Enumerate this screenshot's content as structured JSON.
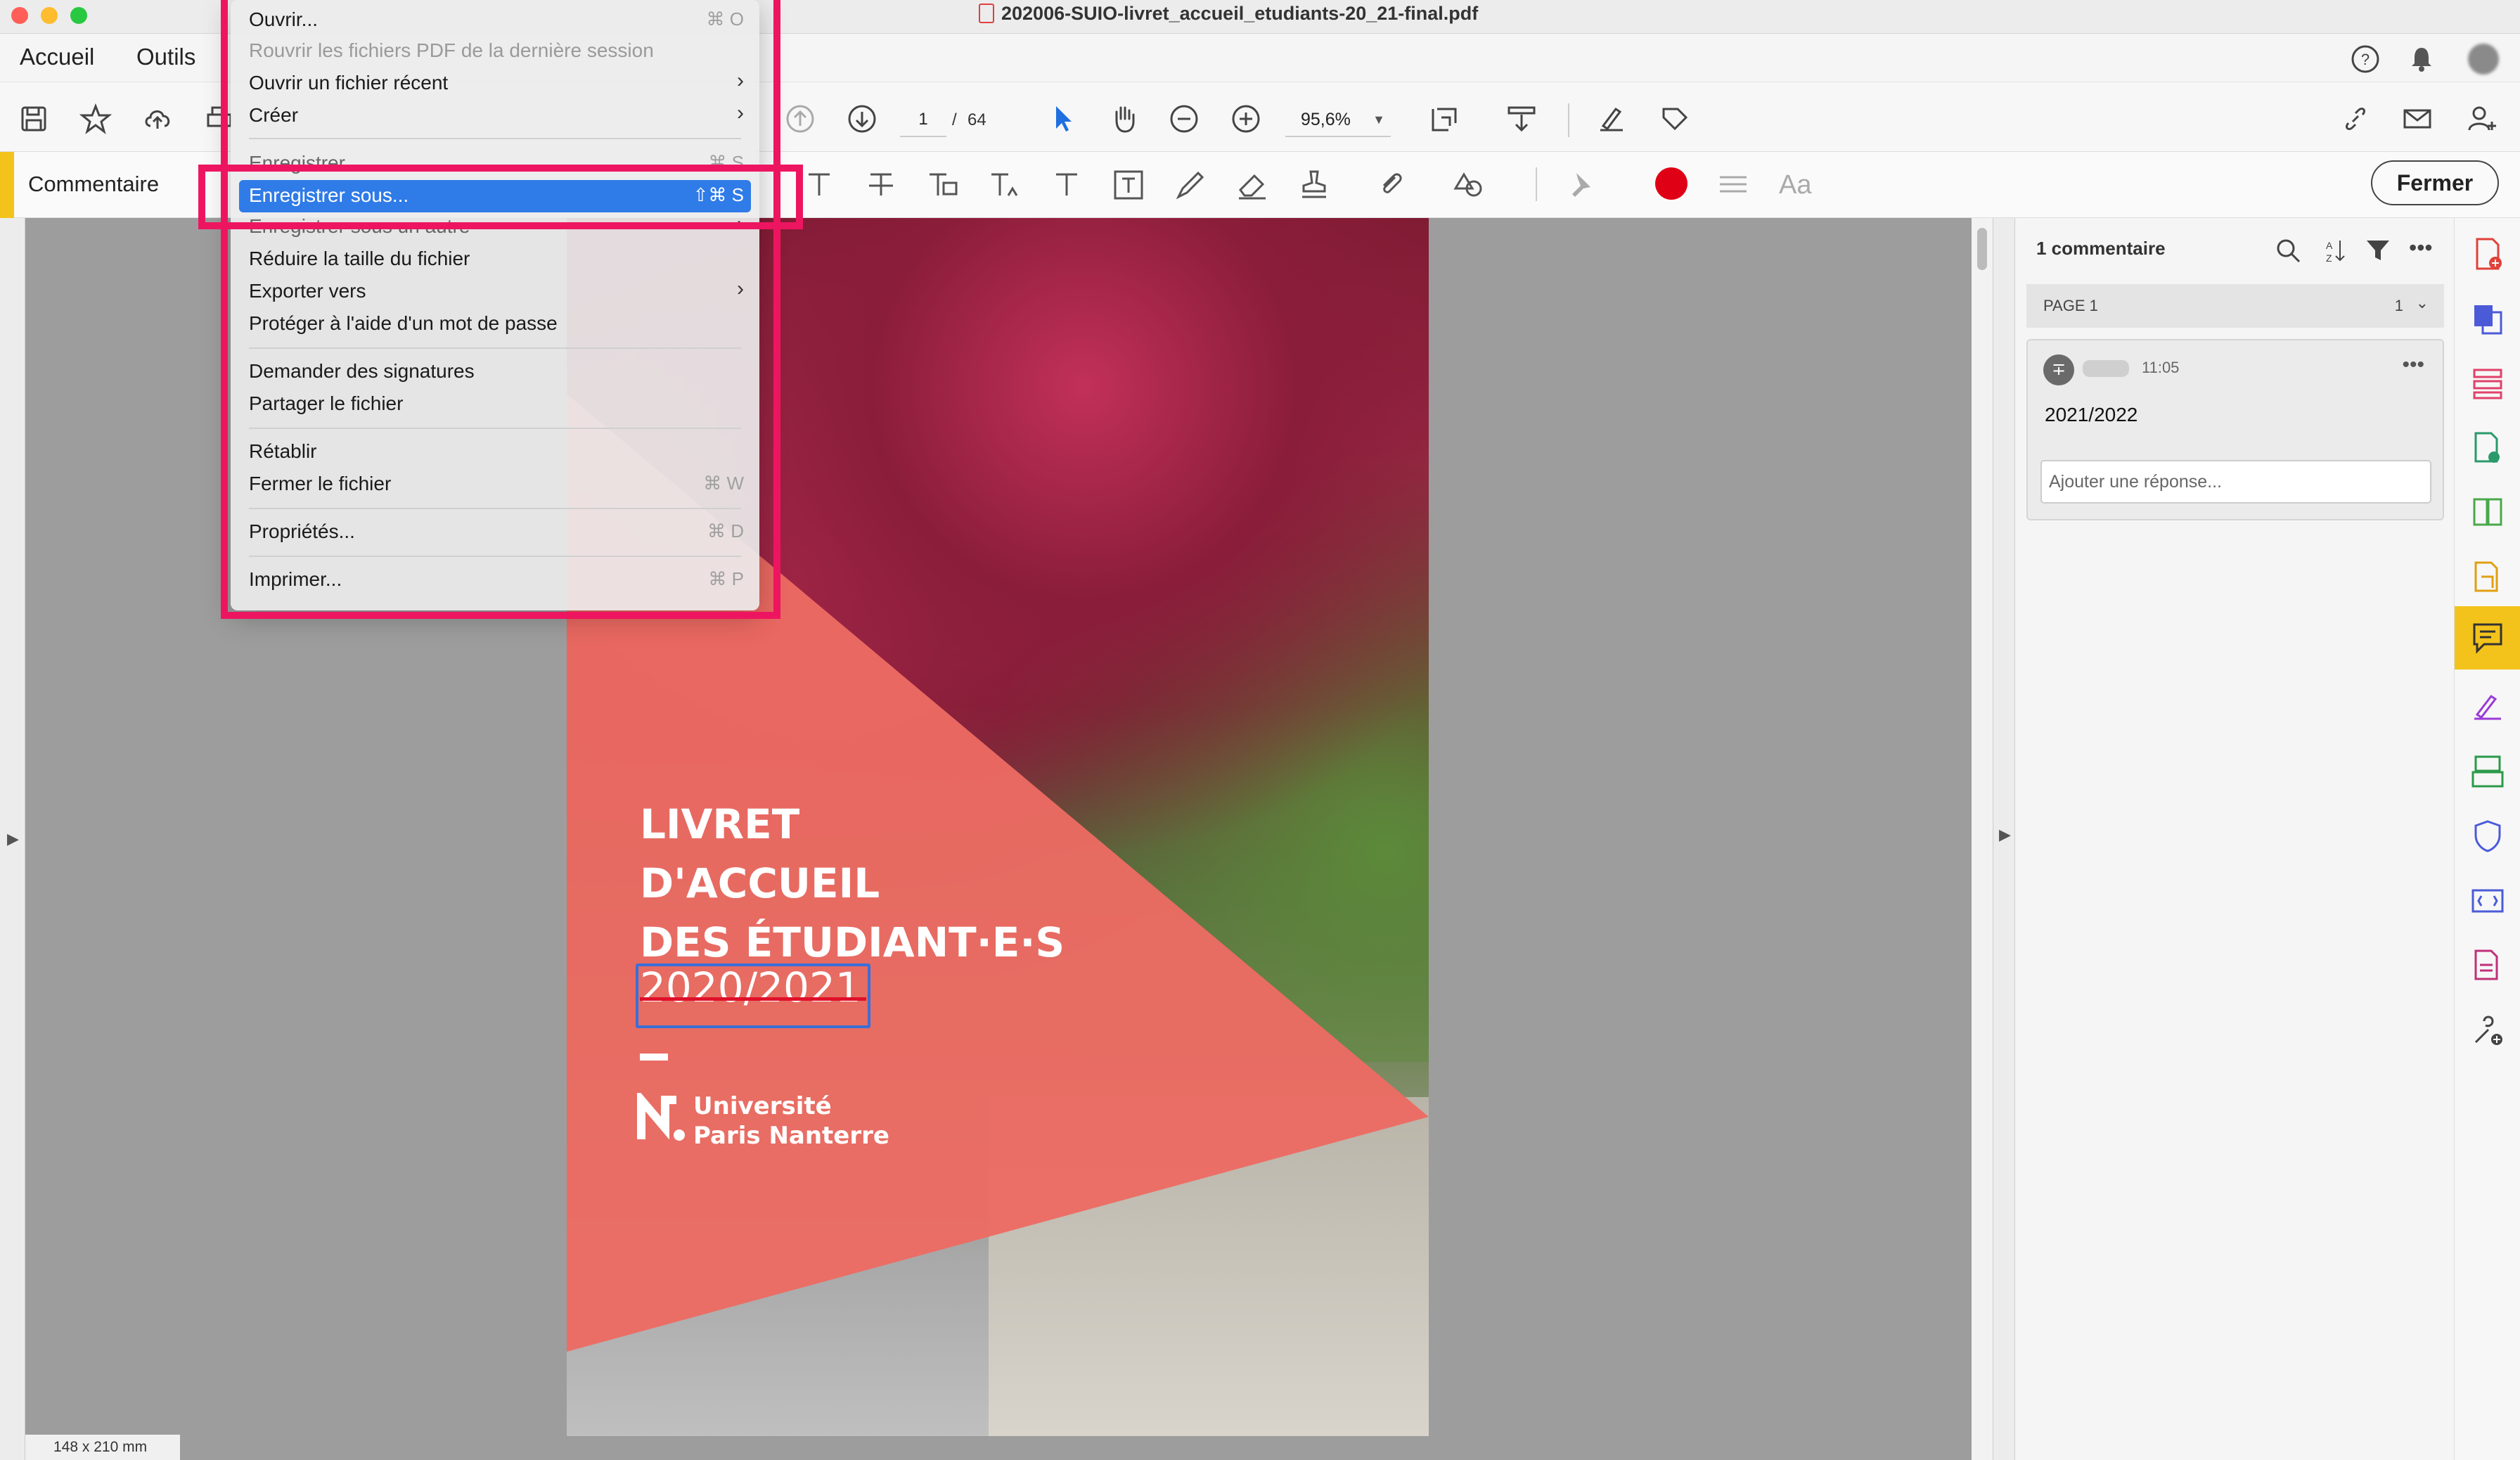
{
  "window": {
    "title": "202006-SUIO-livret_accueil_etudiants-20_21-final.pdf"
  },
  "nav": {
    "tabs": [
      "Accueil",
      "Outils"
    ]
  },
  "toolbar": {
    "page_current": "1",
    "page_separator": "/",
    "page_total": "64",
    "zoom": "95,6%"
  },
  "comment_toolbar": {
    "title": "Commentaire",
    "close_label": "Fermer",
    "color": "#e00015"
  },
  "file_menu": {
    "items": [
      {
        "label": "Ouvrir...",
        "shortcut": "⌘ O",
        "disabled": false,
        "submenu": false
      },
      {
        "label": "Rouvrir les fichiers PDF de la dernière session",
        "shortcut": "",
        "disabled": true,
        "submenu": false
      },
      {
        "label": "Ouvrir un fichier récent",
        "shortcut": "",
        "disabled": false,
        "submenu": true
      },
      {
        "label": "Créer",
        "shortcut": "",
        "disabled": false,
        "submenu": true
      },
      {
        "label": "Enregistrer",
        "shortcut": "⌘ S",
        "disabled": false,
        "submenu": false
      },
      {
        "label": "Enregistrer sous...",
        "shortcut": "⇧⌘ S",
        "disabled": false,
        "submenu": false,
        "selected": true
      },
      {
        "label": "Enregistrer sous un autre",
        "shortcut": "",
        "disabled": false,
        "submenu": true
      },
      {
        "label": "Réduire la taille du fichier",
        "shortcut": "",
        "disabled": false,
        "submenu": false
      },
      {
        "label": "Exporter vers",
        "shortcut": "",
        "disabled": false,
        "submenu": true
      },
      {
        "label": "Protéger à l'aide d'un mot de passe",
        "shortcut": "",
        "disabled": false,
        "submenu": false
      },
      {
        "label": "Demander des signatures",
        "shortcut": "",
        "disabled": false,
        "submenu": false
      },
      {
        "label": "Partager le fichier",
        "shortcut": "",
        "disabled": false,
        "submenu": false
      },
      {
        "label": "Rétablir",
        "shortcut": "",
        "disabled": false,
        "submenu": false
      },
      {
        "label": "Fermer le fichier",
        "shortcut": "⌘ W",
        "disabled": false,
        "submenu": false
      },
      {
        "label": "Propriétés...",
        "shortcut": "⌘ D",
        "disabled": false,
        "submenu": false
      },
      {
        "label": "Imprimer...",
        "shortcut": "⌘ P",
        "disabled": false,
        "submenu": false
      }
    ]
  },
  "pdf_cover": {
    "line1": "LIVRET",
    "line2": "D'ACCUEIL",
    "line3": "DES ÉTUDIANT·E·S",
    "year": "2020/2021",
    "university_line1": "Université",
    "university_line2": "Paris Nanterre"
  },
  "status": {
    "page_size": "148 x 210 mm"
  },
  "comments_panel": {
    "count_label": "1 commentaire",
    "page_label": "PAGE 1",
    "page_num": "1",
    "comment": {
      "avatar_symbol": "∓",
      "time": "11:05",
      "text": "2021/2022",
      "reply_placeholder": "Ajouter une réponse..."
    }
  },
  "right_rail": {
    "icons": [
      "create-pdf-icon",
      "export-pdf-icon",
      "organize-pages-icon",
      "edit-pdf-icon",
      "compare-icon",
      "combine-files-icon",
      "comment-icon",
      "fill-sign-icon",
      "scan-icon",
      "protect-icon",
      "redact-icon",
      "print-production-icon",
      "more-tools-icon"
    ],
    "active": "comment-icon"
  }
}
